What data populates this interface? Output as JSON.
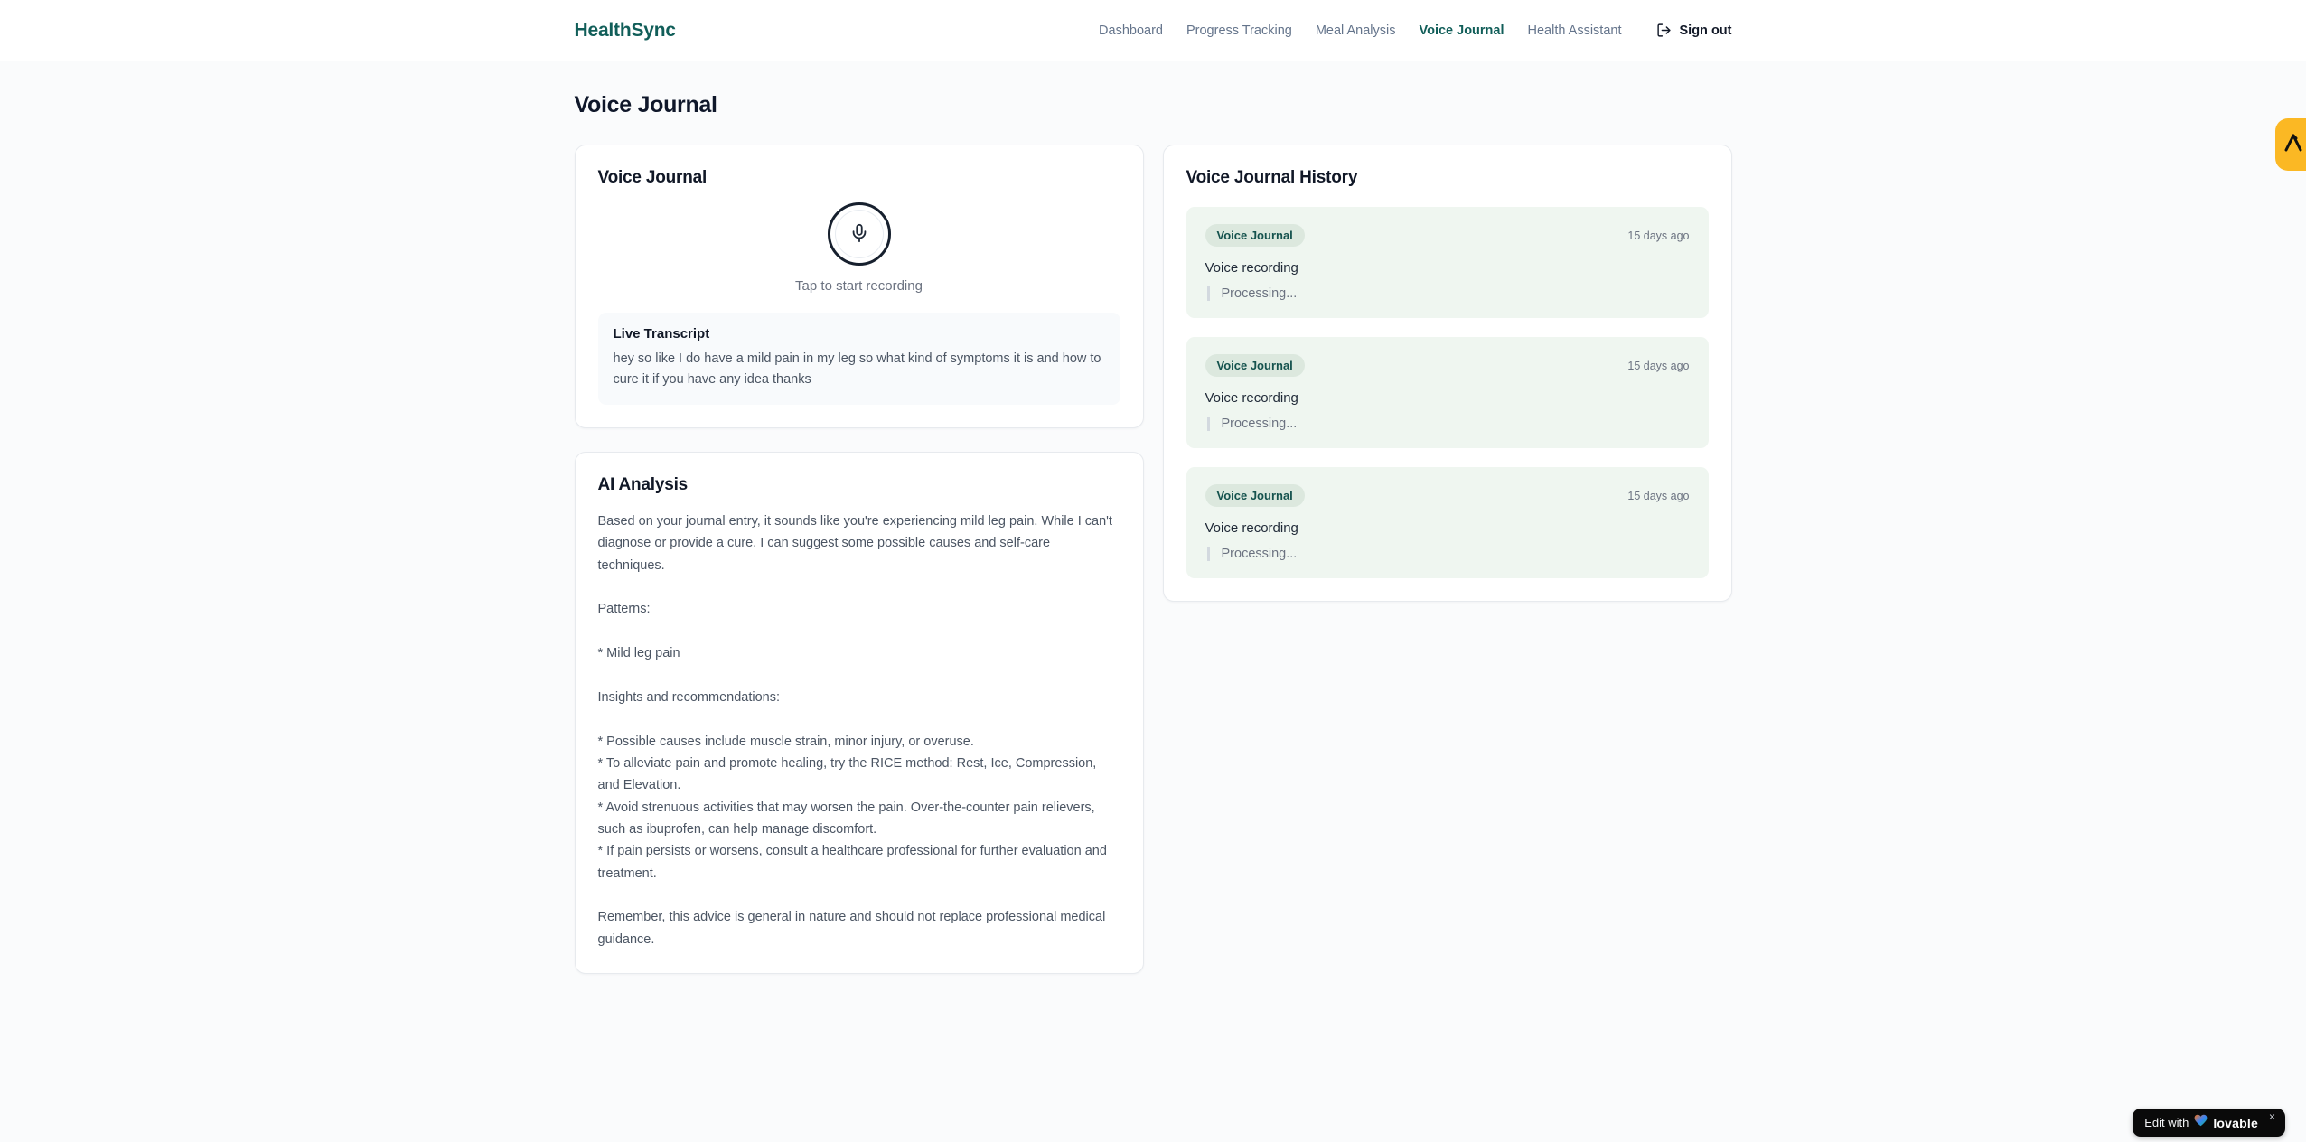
{
  "brand": "HealthSync",
  "nav": {
    "items": [
      {
        "label": "Dashboard",
        "active": false
      },
      {
        "label": "Progress Tracking",
        "active": false
      },
      {
        "label": "Meal Analysis",
        "active": false
      },
      {
        "label": "Voice Journal",
        "active": true
      },
      {
        "label": "Health Assistant",
        "active": false
      }
    ],
    "sign_out_label": "Sign out"
  },
  "page": {
    "title": "Voice Journal"
  },
  "recorder_card": {
    "title": "Voice Journal",
    "mic_icon": "microphone-icon",
    "tap_label": "Tap to start recording",
    "transcript_title": "Live Transcript",
    "transcript_text": "hey so like I do have a mild pain in my leg so what kind of symptoms it is and how to cure it if you have any idea thanks"
  },
  "analysis_card": {
    "title": "AI Analysis",
    "body": "Based on your journal entry, it sounds like you're experiencing mild leg pain. While I can't diagnose or provide a cure, I can suggest some possible causes and self-care techniques.\n\nPatterns:\n\n* Mild leg pain\n\nInsights and recommendations:\n\n* Possible causes include muscle strain, minor injury, or overuse.\n* To alleviate pain and promote healing, try the RICE method: Rest, Ice, Compression, and Elevation.\n* Avoid strenuous activities that may worsen the pain. Over-the-counter pain relievers, such as ibuprofen, can help manage discomfort.\n* If pain persists or worsens, consult a healthcare professional for further evaluation and treatment.\n\nRemember, this advice is general in nature and should not replace professional medical guidance."
  },
  "history_card": {
    "title": "Voice Journal History",
    "entries": [
      {
        "badge": "Voice Journal",
        "time": "15 days ago",
        "title": "Voice recording",
        "status": "Processing..."
      },
      {
        "badge": "Voice Journal",
        "time": "15 days ago",
        "title": "Voice recording",
        "status": "Processing..."
      },
      {
        "badge": "Voice Journal",
        "time": "15 days ago",
        "title": "Voice recording",
        "status": "Processing..."
      }
    ]
  },
  "widgets": {
    "corner_badge_icon": "lovable-logo-icon",
    "lovable_badge": {
      "prefix": "Edit with",
      "heart_icon": "heart-icon",
      "brand": "lovable",
      "close": "×"
    }
  },
  "colors": {
    "accent_teal": "#115e59",
    "nav_gray": "#64748b",
    "entry_green_bg": "#eff6f0",
    "badge_green_bg": "#dce8de",
    "badge_green_text": "#14524d",
    "amber_badge": "#fbb824",
    "mic_border": "#17202e"
  }
}
